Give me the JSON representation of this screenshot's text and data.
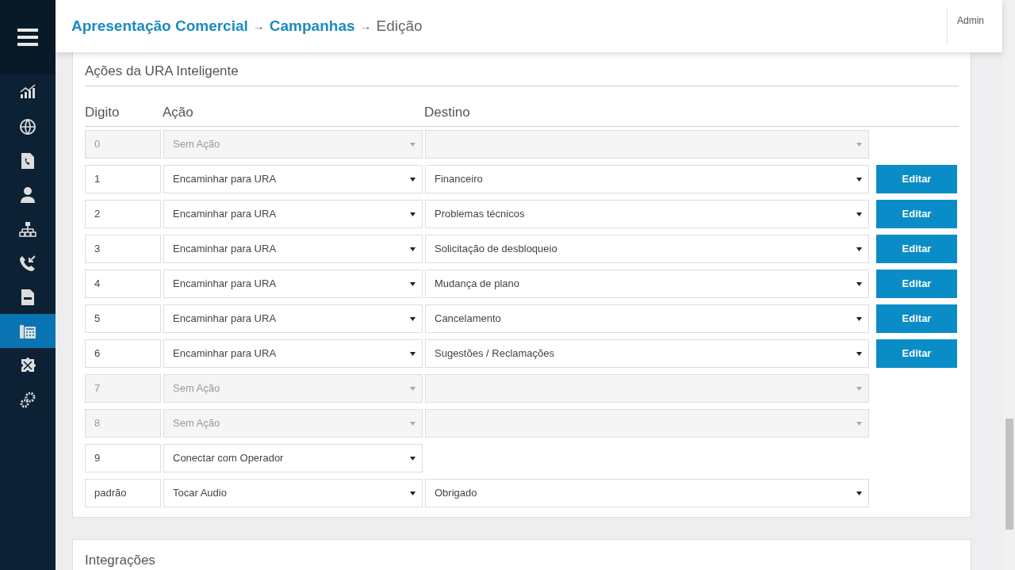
{
  "sidebar": {
    "items": [
      {
        "selected": false
      },
      {
        "selected": false
      },
      {
        "selected": false
      },
      {
        "selected": false
      },
      {
        "selected": false
      },
      {
        "selected": false
      },
      {
        "selected": false
      },
      {
        "selected": true
      },
      {
        "selected": false
      },
      {
        "selected": false
      }
    ]
  },
  "header": {
    "breadcrumb": [
      {
        "label": "Apresentação Comercial",
        "link": true
      },
      {
        "label": "Campanhas",
        "link": true
      },
      {
        "label": "Edição",
        "link": false
      }
    ],
    "separator": "→",
    "user": "Admin"
  },
  "section": {
    "title": "Ações da URA Inteligente",
    "columns": [
      "Digito",
      "Ação",
      "Destino"
    ],
    "rows": [
      {
        "digit": "0",
        "action": "Sem Ação",
        "disabled": true,
        "destination_field": true
      },
      {
        "digit": "1",
        "action": "Encaminhar para URA",
        "disabled": false,
        "destination_field": true,
        "destination": "Financeiro",
        "button": "Editar"
      },
      {
        "digit": "2",
        "action": "Encaminhar para URA",
        "disabled": false,
        "destination_field": true,
        "destination": "Problemas técnicos",
        "button": "Editar"
      },
      {
        "digit": "3",
        "action": "Encaminhar para URA",
        "disabled": false,
        "destination_field": true,
        "destination": "Solicitação de desbloqueio",
        "button": "Editar"
      },
      {
        "digit": "4",
        "action": "Encaminhar para URA",
        "disabled": false,
        "destination_field": true,
        "destination": "Mudança de plano",
        "button": "Editar"
      },
      {
        "digit": "5",
        "action": "Encaminhar para URA",
        "disabled": false,
        "destination_field": true,
        "destination": "Cancelamento",
        "button": "Editar"
      },
      {
        "digit": "6",
        "action": "Encaminhar para URA",
        "disabled": false,
        "destination_field": true,
        "destination": "Sugestões / Reclamações",
        "button": "Editar"
      },
      {
        "digit": "7",
        "action": "Sem Ação",
        "disabled": true,
        "destination_field": true
      },
      {
        "digit": "8",
        "action": "Sem Ação",
        "disabled": true,
        "destination_field": true
      },
      {
        "digit": "9",
        "action": "Conectar com Operador",
        "disabled": false,
        "destination_field": false
      },
      {
        "digit": "padrão",
        "action": "Tocar Audio",
        "disabled": false,
        "destination_field": true,
        "destination": "Obrigado"
      }
    ]
  },
  "next_section": {
    "title": "Integrações"
  }
}
